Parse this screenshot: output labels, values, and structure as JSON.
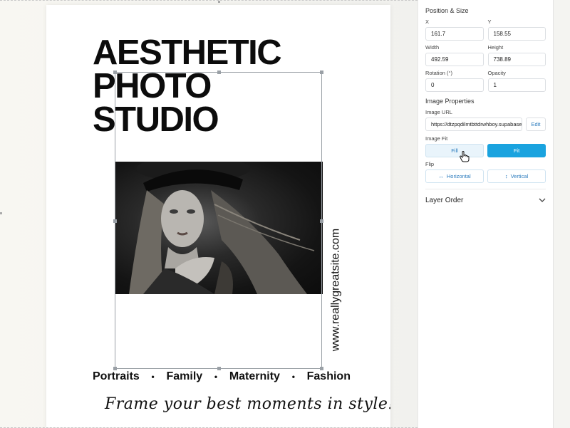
{
  "canvas": {
    "headline_lines": [
      "AESTHETIC",
      "PHOTO",
      "STUDIO"
    ],
    "website": "www.reallygreatsite.com",
    "services": [
      "Portraits",
      "Family",
      "Maternity",
      "Fashion"
    ],
    "separator": "•",
    "tagline": "Frame your best moments in style!"
  },
  "panel": {
    "position_size_title": "Position & Size",
    "x_label": "X",
    "x_value": "161.7",
    "y_label": "Y",
    "y_value": "158.55",
    "width_label": "Width",
    "width_value": "492.59",
    "height_label": "Height",
    "height_value": "738.89",
    "rotation_label": "Rotation (°)",
    "rotation_value": "0",
    "opacity_label": "Opacity",
    "opacity_value": "1",
    "image_properties_title": "Image Properties",
    "image_url_label": "Image URL",
    "image_url_value": "https://dtzpqdilmtbttdrwhboy.supabase",
    "edit_label": "Edit",
    "image_fit_label": "Image Fit",
    "fill_label": "Fill",
    "fit_label": "Fit",
    "flip_label": "Flip",
    "horizontal_label": "Horizontal",
    "vertical_label": "Vertical",
    "layer_order_label": "Layer Order"
  },
  "colors": {
    "accent": "#1aa3df",
    "accent_light": "#e9f4fb",
    "link_blue": "#2b7bbd"
  },
  "icons": {
    "horizontal_flip": "double-arrow-horizontal-icon",
    "vertical_flip": "double-arrow-vertical-icon",
    "layer_order_toggle": "chevron-down-icon",
    "cursor": "hand-pointer-icon"
  }
}
